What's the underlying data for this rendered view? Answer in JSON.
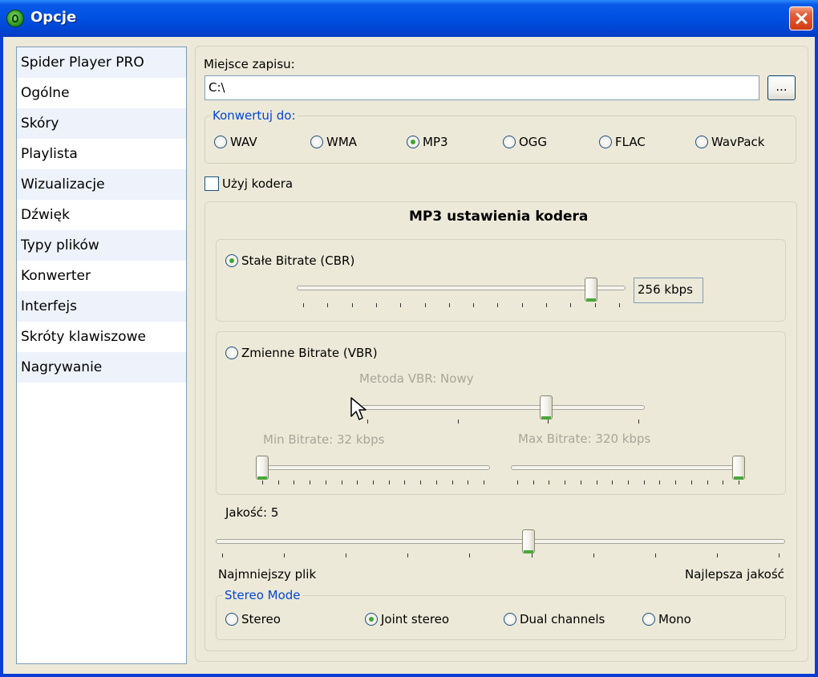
{
  "window": {
    "title": "Opcje"
  },
  "sidebar": {
    "items": [
      "Spider Player PRO",
      "Ogólne",
      "Skóry",
      "Playlista",
      "Wizualizacje",
      "Dźwięk",
      "Typy plików",
      "Konwerter",
      "Interfejs",
      "Skróty klawiszowe",
      "Nagrywanie"
    ]
  },
  "converter": {
    "save_location_label": "Miejsce zapisu:",
    "save_location_value": "C:\\",
    "browse_label": "...",
    "convert_to_legend": "Konwertuj do:",
    "formats": [
      {
        "label": "WAV",
        "selected": false
      },
      {
        "label": "WMA",
        "selected": false
      },
      {
        "label": "MP3",
        "selected": true
      },
      {
        "label": "OGG",
        "selected": false
      },
      {
        "label": "FLAC",
        "selected": false
      },
      {
        "label": "WavPack",
        "selected": false
      }
    ],
    "use_encoder_label": "Użyj kodera",
    "use_encoder_checked": false
  },
  "encoder": {
    "title": "MP3 ustawienia kodera",
    "cbr": {
      "label": "Stałe Bitrate (CBR)",
      "selected": true,
      "value": "256 kbps",
      "slider_position": 0.91
    },
    "vbr": {
      "label": "Zmienne Bitrate (VBR)",
      "selected": false,
      "method_label": "Metoda VBR: Nowy",
      "method_position": 0.66,
      "min_label": "Min Bitrate: 32 kbps",
      "min_position": 0.0,
      "max_label": "Max Bitrate: 320 kbps",
      "max_position": 1.0
    },
    "quality": {
      "label": "Jakość: 5",
      "position": 0.55,
      "min_caption": "Najmniejszy plik",
      "max_caption": "Najlepsza jakość"
    },
    "stereo": {
      "legend": "Stereo Mode",
      "options": [
        {
          "label": "Stereo",
          "selected": false
        },
        {
          "label": "Joint stereo",
          "selected": true
        },
        {
          "label": "Dual channels",
          "selected": false
        },
        {
          "label": "Mono",
          "selected": false
        }
      ]
    }
  },
  "colors": {
    "titlebar": "#0051e2",
    "window_bg": "#ece9d8",
    "legend_text": "#0046d5",
    "radio_dot": "#3ea82c"
  }
}
